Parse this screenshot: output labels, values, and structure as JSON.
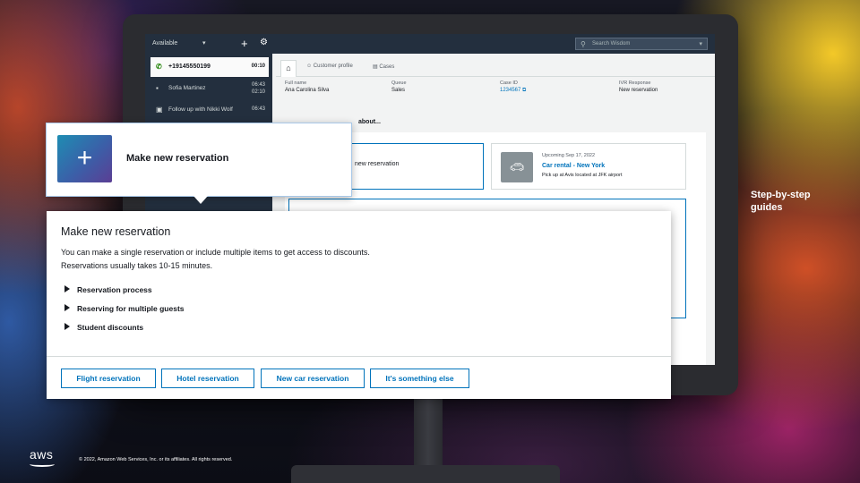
{
  "topbar": {
    "status": "Available",
    "search_placeholder": "Search Wisdom"
  },
  "contacts": [
    {
      "label": "+19145550199",
      "time": "00:10"
    },
    {
      "label": "Sofia Martinez",
      "time1": "06:43",
      "time2": "02:10"
    },
    {
      "label": "Follow up with Nikki Wolf",
      "time": "06:43"
    }
  ],
  "tabs": [
    "Customer profile",
    "Cases"
  ],
  "fields": [
    {
      "label": "Full name",
      "value": "Ana Carolina Silva"
    },
    {
      "label": "Queue",
      "value": "Sales"
    },
    {
      "label": "Case ID",
      "value": "1234567"
    },
    {
      "label": "IVR Response",
      "value": "New reservation"
    }
  ],
  "about_prefix": "about...",
  "tiles": {
    "selected_text": "new reservation",
    "car": {
      "date": "Upcoming Sep 17, 2022",
      "title": "Car rental - New York",
      "subtitle": "Pick up at Avis located at JFK airport"
    }
  },
  "callout": {
    "label": "Make new reservation"
  },
  "detail": {
    "title": "Make new reservation",
    "desc_line1": "You can make a single reservation or include multiple items to get access to discounts.",
    "desc_line2": "Reservations usually takes 10-15 minutes.",
    "expandables": [
      "Reservation process",
      "Reserving for multiple guests",
      "Student discounts"
    ],
    "buttons": [
      "Flight reservation",
      "Hotel reservation",
      "New car reservation",
      "It's something else"
    ]
  },
  "side_label_line1": "Step-by-step",
  "side_label_line2": "guides",
  "footer": {
    "logo": "aws",
    "copyright": "© 2022, Amazon Web Services, Inc. or its affiliates. All rights reserved."
  },
  "colors": {
    "accent": "#0073bb",
    "nav_dark": "#232f3e"
  }
}
